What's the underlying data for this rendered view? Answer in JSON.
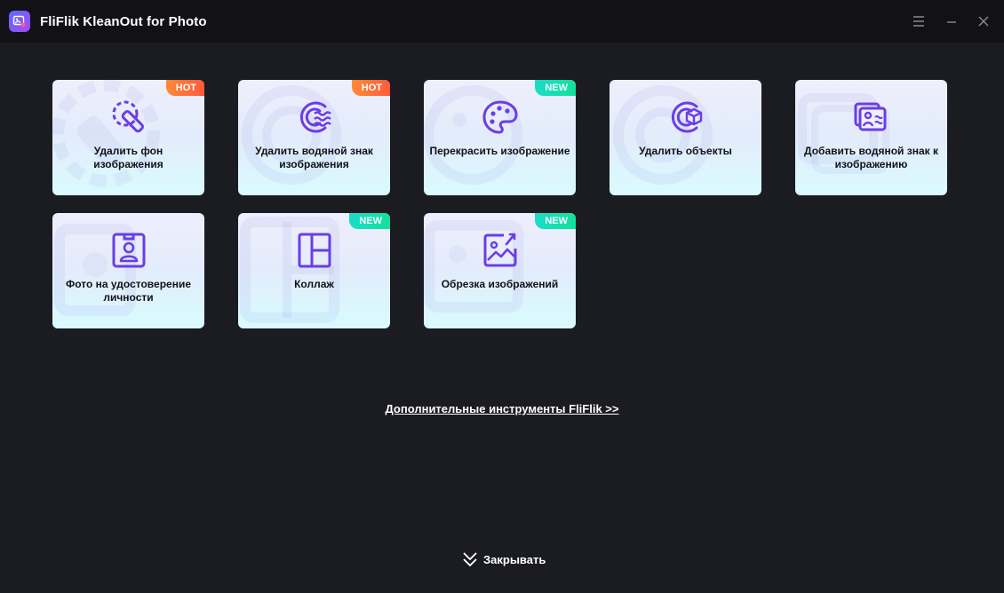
{
  "window": {
    "title": "FliFlik KleanOut for Photo"
  },
  "tools": [
    {
      "label": "Удалить фон изображения",
      "badge": "HOT",
      "icon": "eraser-icon"
    },
    {
      "label": "Удалить водяной знак изображения",
      "badge": "HOT",
      "icon": "watermark-remove-icon"
    },
    {
      "label": "Перекрасить изображение",
      "badge": "NEW",
      "icon": "palette-icon"
    },
    {
      "label": "Удалить объекты",
      "badge": "",
      "icon": "object-remove-icon"
    },
    {
      "label": "Добавить водяной знак к изображению",
      "badge": "",
      "icon": "watermark-add-icon"
    },
    {
      "label": "Фото на удостоверение личности",
      "badge": "",
      "icon": "id-photo-icon"
    },
    {
      "label": "Коллаж",
      "badge": "NEW",
      "icon": "collage-icon"
    },
    {
      "label": "Обрезка изображений",
      "badge": "NEW",
      "icon": "crop-image-icon"
    }
  ],
  "more_tools_link": "Дополнительные инструменты FliFlik >>",
  "collapse_label": "Закрывать",
  "colors": {
    "background": "#1b1b22",
    "titlebar": "#111116",
    "icon_accent": "#6a3de8",
    "hot_badge": "#ff6a3a",
    "new_badge": "#14dfb0"
  }
}
